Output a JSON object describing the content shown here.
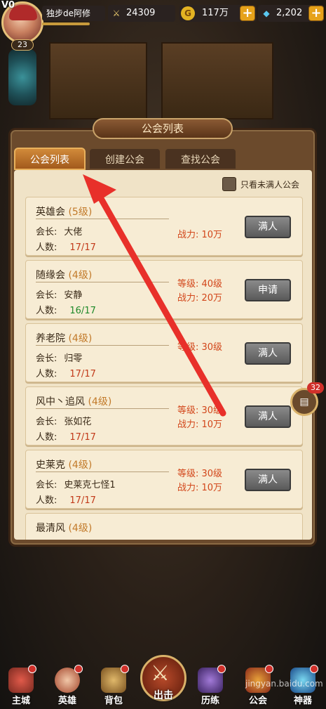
{
  "header": {
    "vip": "V0",
    "level": "23",
    "player_name": "独步de阿修",
    "power": "24309",
    "gold": "117万",
    "gems": "2,202",
    "power_icon": "sword-icon",
    "gold_icon": "coin-icon",
    "gem_icon": "gem-icon"
  },
  "panel": {
    "title": "公会列表",
    "tabs": [
      {
        "label": "公会列表"
      },
      {
        "label": "创建公会"
      },
      {
        "label": "查找公会"
      }
    ],
    "filter_label": "只看未满人公会"
  },
  "guilds": [
    {
      "name": "英雄会",
      "level": "(5级)",
      "leader_label": "会长:",
      "leader": "大佬",
      "members_label": "人数:",
      "members": "17/17",
      "level_stat": "",
      "power_stat": "战力: 10万",
      "button": "满人"
    },
    {
      "name": "随缘会",
      "level": "(4级)",
      "leader_label": "会长:",
      "leader": "安静",
      "members_label": "人数:",
      "members": "16/17",
      "level_stat": "等级: 40级",
      "power_stat": "战力: 20万",
      "button": "申请"
    },
    {
      "name": "养老院",
      "level": "(4级)",
      "leader_label": "会长:",
      "leader": "归零",
      "members_label": "人数:",
      "members": "17/17",
      "level_stat": "等级: 30级",
      "power_stat": "",
      "button": "满人"
    },
    {
      "name": "风中丶追风",
      "level": "(4级)",
      "leader_label": "会长:",
      "leader": "张如花",
      "members_label": "人数:",
      "members": "17/17",
      "level_stat": "等级: 30级",
      "power_stat": "战力: 10万",
      "button": "满人"
    },
    {
      "name": "史莱克",
      "level": "(4级)",
      "leader_label": "会长:",
      "leader": "史莱克七怪1",
      "members_label": "人数:",
      "members": "17/17",
      "level_stat": "等级: 30级",
      "power_stat": "战力: 10万",
      "button": "满人"
    },
    {
      "name": "最清风",
      "level": "(4级)"
    }
  ],
  "chat": {
    "badge": "32",
    "icon": "chat-icon"
  },
  "nav": [
    {
      "label": "主城",
      "icon": "castle-icon"
    },
    {
      "label": "英雄",
      "icon": "hero-icon"
    },
    {
      "label": "背包",
      "icon": "bag-icon"
    },
    {
      "label": "出击",
      "icon": "crossed-swords-icon"
    },
    {
      "label": "历练",
      "icon": "tower-icon"
    },
    {
      "label": "公会",
      "icon": "guild-icon"
    },
    {
      "label": "神器",
      "icon": "crystal-icon"
    }
  ],
  "watermark": "jingyan.baidu.com"
}
